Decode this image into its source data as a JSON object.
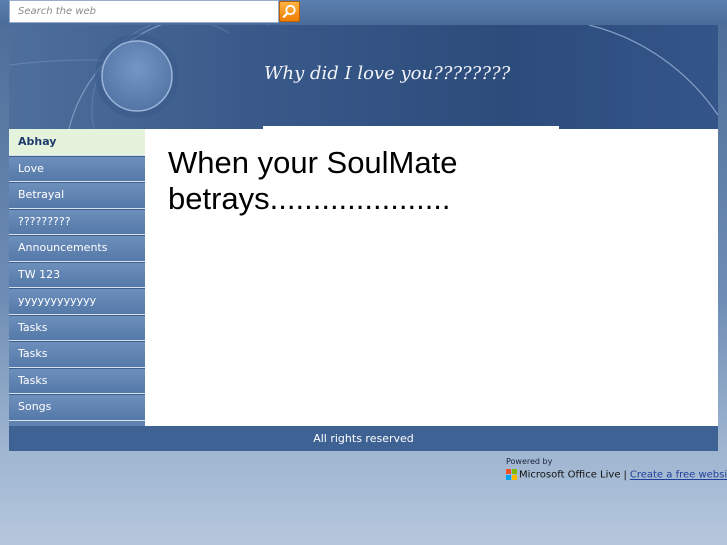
{
  "search": {
    "placeholder": "Search the web",
    "button_icon": "search-icon"
  },
  "banner": {
    "title": "Why did I love you????????"
  },
  "sidebar": {
    "items": [
      {
        "label": "Abhay",
        "active": true
      },
      {
        "label": "Love"
      },
      {
        "label": "Betrayal"
      },
      {
        "label": "?????????"
      },
      {
        "label": "Announcements"
      },
      {
        "label": "TW 123"
      },
      {
        "label": "yyyyyyyyyyyy"
      },
      {
        "label": "Tasks"
      },
      {
        "label": "Tasks"
      },
      {
        "label": "Tasks"
      },
      {
        "label": "Songs"
      }
    ]
  },
  "content": {
    "heading": "When your SoulMate betrays....................."
  },
  "footer": {
    "rights": "All rights reserved",
    "powered_by": "Powered by",
    "office_brand": "Microsoft Office Live",
    "separator": "|",
    "create_link": "Create a free website",
    "logo_icon": "office-live-logo-icon"
  },
  "colors": {
    "accent_orange": "#f07d00",
    "banner_blue": "#2c4c7c",
    "nav_blue": "#6d8fbc",
    "active_nav": "#e5f3dc"
  }
}
